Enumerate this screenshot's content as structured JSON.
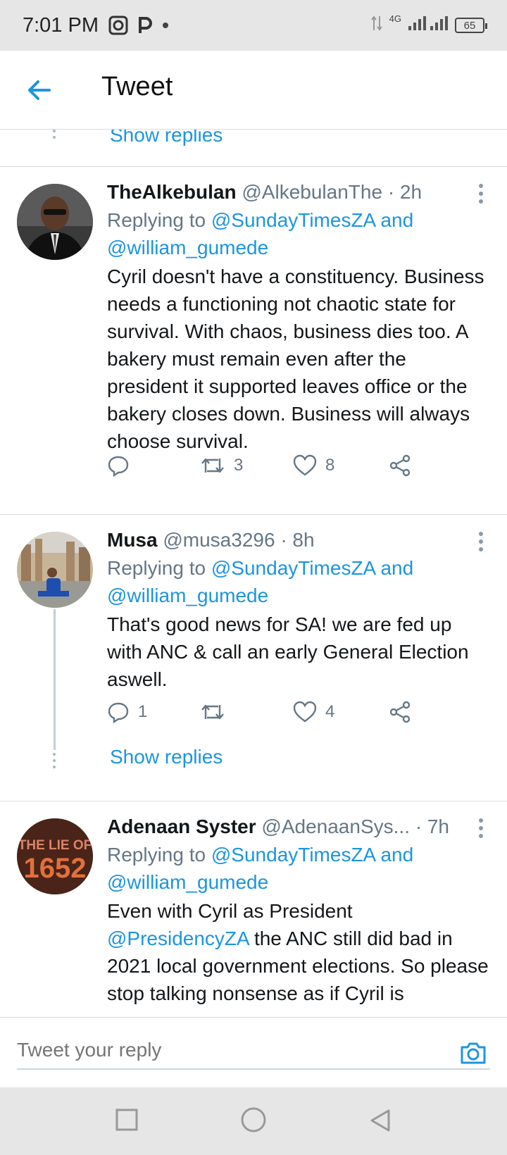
{
  "status_bar": {
    "time": "7:01 PM",
    "network": "4G",
    "battery": "65"
  },
  "header": {
    "title": "Tweet"
  },
  "show_replies_label": "Show replies",
  "tweets": [
    {
      "name": "TheAlkebulan",
      "handle": "@AlkebulanThe",
      "time": "· 2h",
      "replying_prefix": "Replying to ",
      "replying_handle1": "@SundayTimesZA",
      "replying_and": " and",
      "replying_handle2": "@william_gumede",
      "body": "Cyril doesn't have a constituency. Business needs a functioning not chaotic state for survival. With chaos, business dies too. A bakery must remain even after the president it supported leaves office or the bakery closes down. Business will always choose survival.",
      "replies": "",
      "retweets": "3",
      "likes": "8"
    },
    {
      "name": "Musa",
      "handle": "@musa3296",
      "time": "· 8h",
      "replying_prefix": "Replying to ",
      "replying_handle1": "@SundayTimesZA",
      "replying_and": " and",
      "replying_handle2": "@william_gumede",
      "body": "That's good news for SA! we are fed up with ANC & call an early General Election aswell.",
      "replies": "1",
      "retweets": "",
      "likes": "4"
    },
    {
      "name": "Adenaan Syster",
      "handle": "@AdenaanSys...",
      "time": "· 7h",
      "replying_prefix": "Replying to ",
      "replying_handle1": "@SundayTimesZA",
      "replying_and": " and",
      "replying_handle2": "@william_gumede",
      "body_prefix": "Even with Cyril as President",
      "body_mention": "@PresidencyZA",
      "body_rest": " the ANC still did bad in 2021 local government elections. So please stop talking nonsense as if Cyril is",
      "avatar_text1": "THE LIE OF",
      "avatar_text2": "1652"
    }
  ],
  "reply_bar": {
    "placeholder": "Tweet your reply"
  },
  "colors": {
    "accent": "#1b95e0",
    "secondary_text": "#657786"
  },
  "icons": [
    "back-arrow-icon",
    "reply-icon",
    "retweet-icon",
    "like-icon",
    "share-icon",
    "more-icon",
    "camera-icon",
    "nav-square-icon",
    "nav-circle-icon",
    "nav-triangle-icon"
  ]
}
